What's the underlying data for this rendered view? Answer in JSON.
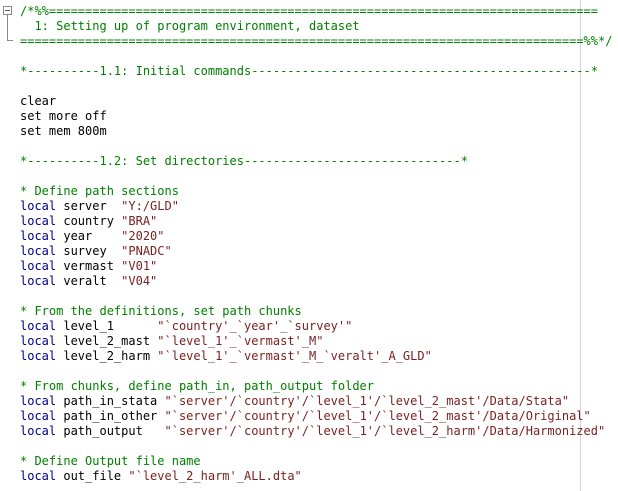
{
  "editor": {
    "colors": {
      "comment": "#008000",
      "keyword": "#00008b",
      "string": "#7a1f1f",
      "text": "#000000"
    },
    "fold_icon": "minus-fold-icon",
    "lines": [
      {
        "kind": "comment",
        "text": "/*%%============================================================================"
      },
      {
        "kind": "comment",
        "text": "  1: Setting up of program environment, dataset"
      },
      {
        "kind": "comment",
        "text": "==============================================================================%%*/"
      },
      {
        "kind": "blank",
        "text": ""
      },
      {
        "kind": "comment",
        "text": "*----------1.1: Initial commands-----------------------------------------------*"
      },
      {
        "kind": "blank",
        "text": ""
      },
      {
        "kind": "plain",
        "text": "clear"
      },
      {
        "kind": "plain",
        "text": "set more off"
      },
      {
        "kind": "plain",
        "text": "set mem 800m"
      },
      {
        "kind": "blank",
        "text": ""
      },
      {
        "kind": "comment",
        "text": "*----------1.2: Set directories------------------------------*"
      },
      {
        "kind": "blank",
        "text": ""
      },
      {
        "kind": "comment",
        "text": "* Define path sections"
      },
      {
        "kind": "local",
        "keyword": "local",
        "name": " server  ",
        "value": "\"Y:/GLD\""
      },
      {
        "kind": "local",
        "keyword": "local",
        "name": " country ",
        "value": "\"BRA\""
      },
      {
        "kind": "local",
        "keyword": "local",
        "name": " year    ",
        "value": "\"2020\""
      },
      {
        "kind": "local",
        "keyword": "local",
        "name": " survey  ",
        "value": "\"PNADC\""
      },
      {
        "kind": "local",
        "keyword": "local",
        "name": " vermast ",
        "value": "\"V01\""
      },
      {
        "kind": "local",
        "keyword": "local",
        "name": " veralt  ",
        "value": "\"V04\""
      },
      {
        "kind": "blank",
        "text": ""
      },
      {
        "kind": "comment",
        "text": "* From the definitions, set path chunks"
      },
      {
        "kind": "local",
        "keyword": "local",
        "name": " level_1      ",
        "value": "\"`country'_`year'_`survey'\""
      },
      {
        "kind": "local",
        "keyword": "local",
        "name": " level_2_mast ",
        "value": "\"`level_1'_`vermast'_M\""
      },
      {
        "kind": "local",
        "keyword": "local",
        "name": " level_2_harm ",
        "value": "\"`level_1'_`vermast'_M_`veralt'_A_GLD\""
      },
      {
        "kind": "blank",
        "text": ""
      },
      {
        "kind": "comment",
        "text": "* From chunks, define path_in, path_output folder"
      },
      {
        "kind": "local",
        "keyword": "local",
        "name": " path_in_stata ",
        "value": "\"`server'/`country'/`level_1'/`level_2_mast'/Data/Stata\""
      },
      {
        "kind": "local",
        "keyword": "local",
        "name": " path_in_other ",
        "value": "\"`server'/`country'/`level_1'/`level_2_mast'/Data/Original\""
      },
      {
        "kind": "local",
        "keyword": "local",
        "name": " path_output   ",
        "value": "\"`server'/`country'/`level_1'/`level_2_harm'/Data/Harmonized\""
      },
      {
        "kind": "blank",
        "text": ""
      },
      {
        "kind": "comment",
        "text": "* Define Output file name"
      },
      {
        "kind": "local",
        "keyword": "local",
        "name": " out_file ",
        "value": "\"`level_2_harm'_ALL.dta\""
      }
    ]
  }
}
